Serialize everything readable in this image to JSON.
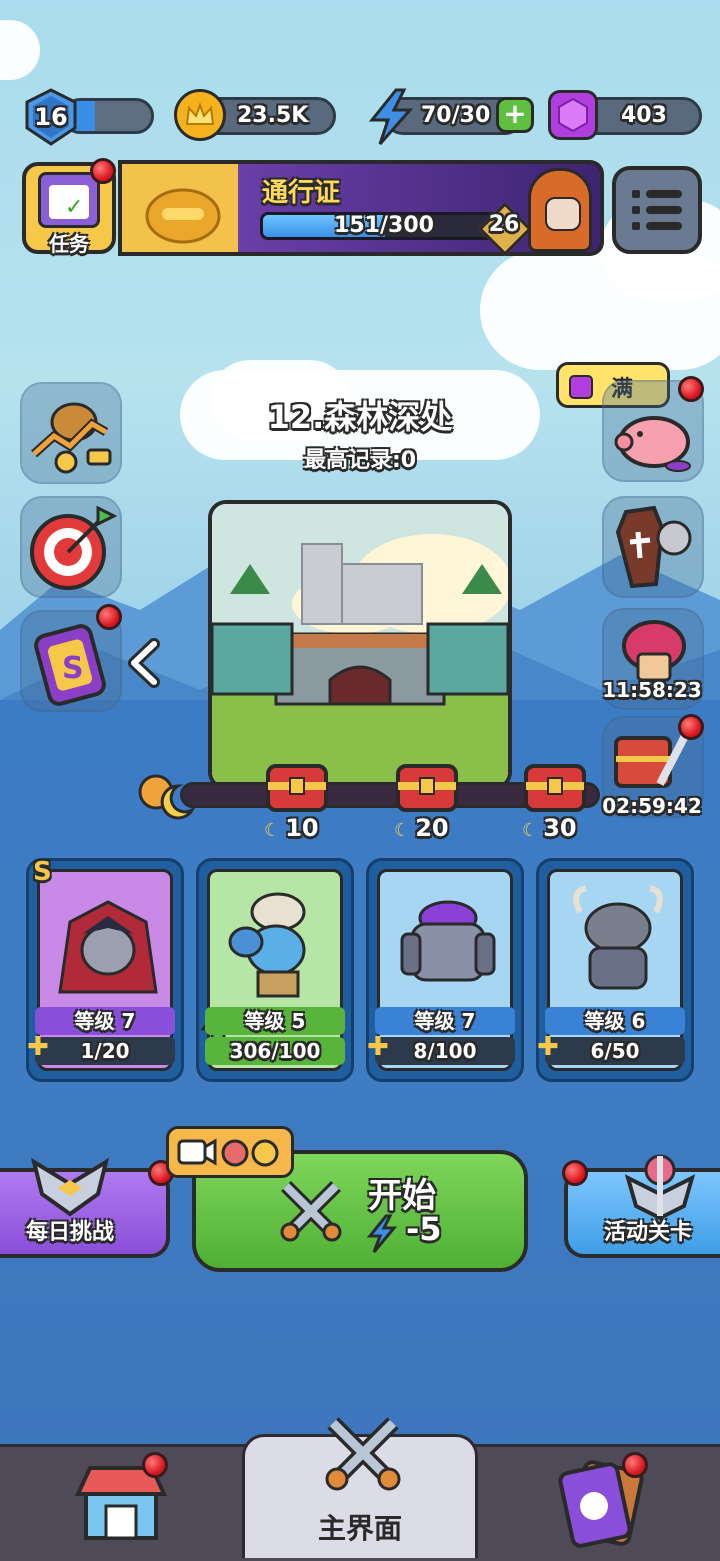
{
  "player": {
    "level": "16",
    "xp_progress": 0.35
  },
  "currency": {
    "coins": "23.5K",
    "energy": "70/30",
    "gems": "403"
  },
  "tasks": {
    "label": "任务"
  },
  "battle_pass": {
    "title": "通行证",
    "progress": "151/300",
    "progress_value": 0.503,
    "tier": "26"
  },
  "piggy_bank": {
    "label": "满"
  },
  "stage": {
    "title": "12.森林深处",
    "record": "最高记录:0"
  },
  "timers": {
    "event_1": "11:58:23",
    "event_2": "02:59:42"
  },
  "chests": [
    {
      "label": "10"
    },
    {
      "label": "20"
    },
    {
      "label": "30"
    }
  ],
  "heroes": [
    {
      "name": "vampire",
      "rank": "S",
      "level": "等级 7",
      "progress": "1/20",
      "fill": 0.05,
      "color": "#9b3fd6"
    },
    {
      "name": "viking-cow",
      "rank": "",
      "level": "等级 5",
      "progress": "306/100",
      "fill": 1.0,
      "color": "#58b43a"
    },
    {
      "name": "stone-golem",
      "rank": "",
      "level": "等级 7",
      "progress": "8/100",
      "fill": 0.08,
      "color": "#3a82d6"
    },
    {
      "name": "horned-warrior",
      "rank": "",
      "level": "等级 6",
      "progress": "6/50",
      "fill": 0.12,
      "color": "#3a82d6"
    }
  ],
  "buttons": {
    "daily_challenge": "每日挑战",
    "start": "开始",
    "start_cost": "-5",
    "event_stage": "活动关卡"
  },
  "nav": {
    "main": "主界面"
  },
  "colors": {
    "start_green": "#5fbf3f",
    "purple": "#8a4fd9",
    "blue": "#3f9ee6"
  }
}
